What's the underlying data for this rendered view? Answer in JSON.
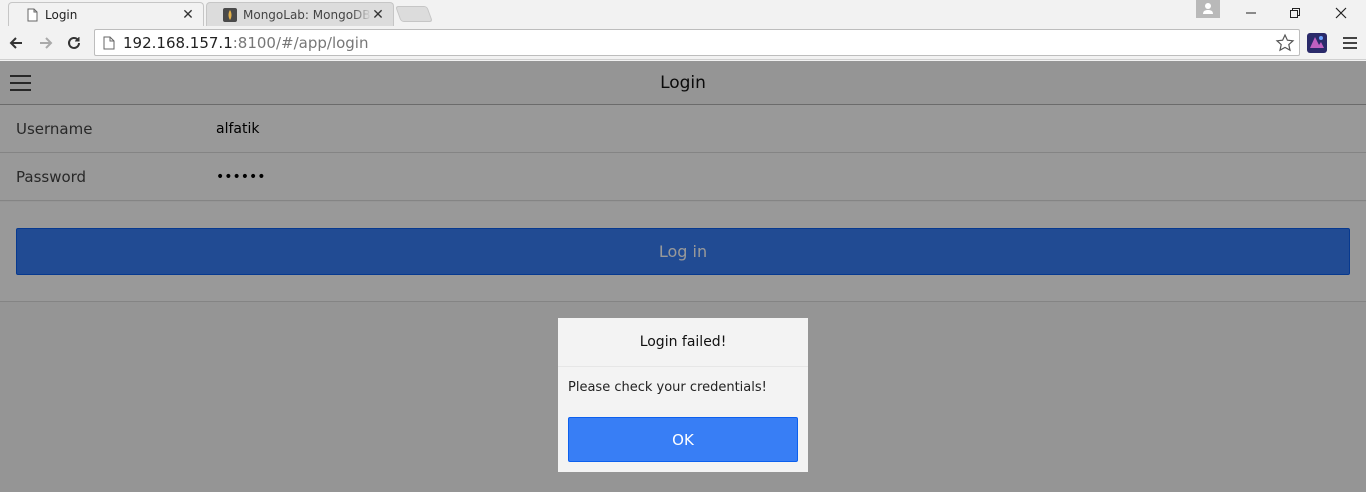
{
  "browser": {
    "tabs": [
      {
        "title": "Login",
        "active": true
      },
      {
        "title": "MongoLab: MongoDB-as-a-Service",
        "active": false
      }
    ],
    "url_host": "192.168.157.1",
    "url_path": ":8100/#/app/login"
  },
  "app": {
    "title": "Login",
    "form": {
      "username_label": "Username",
      "username_value": "alfatik",
      "password_label": "Password",
      "password_value": "••••••"
    },
    "login_button": "Log in"
  },
  "popup": {
    "title": "Login failed!",
    "message": "Please check your credentials!",
    "ok_label": "OK"
  },
  "colors": {
    "button": "#387ef5",
    "overlay": "rgba(0,0,0,0.4)"
  }
}
